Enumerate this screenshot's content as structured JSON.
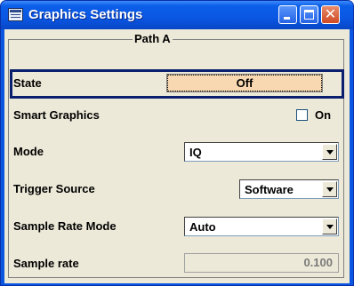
{
  "window": {
    "title": "Graphics Settings",
    "icon": "dialog-icon",
    "controls": {
      "minimize": "minimize-icon",
      "maximize": "maximize-icon",
      "close": "close-icon"
    }
  },
  "group": {
    "title": "Path A"
  },
  "rows": {
    "state": {
      "label": "State",
      "value": "Off"
    },
    "smart_graphics": {
      "label": "Smart Graphics",
      "checkbox_label": "On",
      "checked": false
    },
    "mode": {
      "label": "Mode",
      "value": "IQ"
    },
    "trigger_source": {
      "label": "Trigger Source",
      "value": "Software"
    },
    "sample_rate_mode": {
      "label": "Sample Rate Mode",
      "value": "Auto"
    },
    "sample_rate": {
      "label": "Sample rate",
      "value": "0.100"
    }
  },
  "colors": {
    "titlebar": "#0a57e3",
    "client": "#ece9d8",
    "state_button": "#f8d8b0",
    "selection_frame": "#0a1f6e"
  }
}
